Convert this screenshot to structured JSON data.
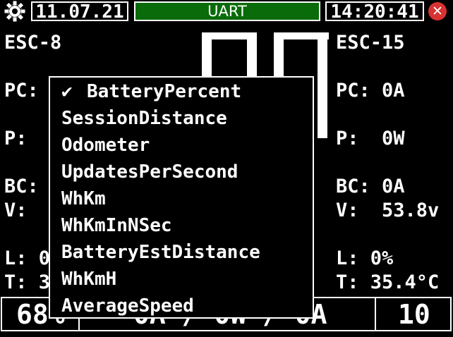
{
  "header": {
    "date": "11.07.21",
    "connection": "UART",
    "time": "14:20:41",
    "status_color": "#0a6b0a",
    "close_color": "#d83232"
  },
  "left_panel": {
    "title": "ESC-8",
    "pc": "PC:",
    "p": "P:",
    "bc": "BC:",
    "v": "V:",
    "l": "L: 0",
    "t": "T: 3"
  },
  "right_panel": {
    "title": "ESC-15",
    "pc": "PC: 0A",
    "p": "P:  0W",
    "bc": "BC: 0A",
    "v": "V:  53.8v",
    "l": "L: 0%",
    "t": "T: 35.4°C"
  },
  "bottom": {
    "left": "68%",
    "middle": "0A / 0W / 0A",
    "right": "10"
  },
  "menu": {
    "checkmark": "✔",
    "items": [
      "BatteryPercent",
      "SessionDistance",
      "Odometer",
      "UpdatesPerSecond",
      "WhKm",
      "WhKmInNSec",
      "BatteryEstDistance",
      "WhKmH",
      "AverageSpeed"
    ],
    "selected_index": 0
  }
}
